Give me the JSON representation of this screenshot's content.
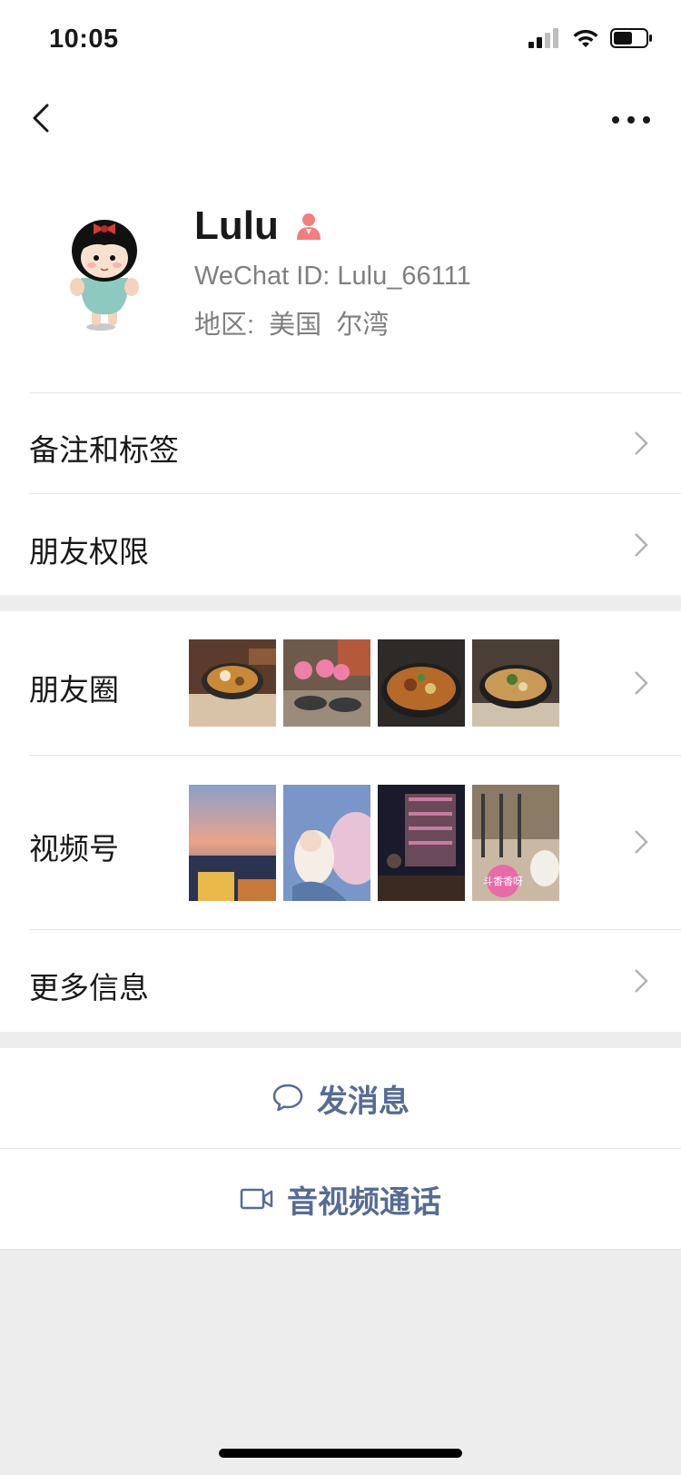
{
  "status": {
    "time": "10:05"
  },
  "profile": {
    "name": "Lulu",
    "wechat_id": "WeChat ID: Lulu_66111",
    "region_label": "地区:",
    "region_country": "美国",
    "region_city": "尔湾"
  },
  "menu": {
    "remarks_tags": "备注和标签",
    "friend_permissions": "朋友权限",
    "moments": "朋友圈",
    "channels": "视频号",
    "more_info": "更多信息"
  },
  "channels_thumb_caption": "斗香香呀",
  "actions": {
    "send_message": "发消息",
    "av_call": "音视频通话"
  },
  "colors": {
    "accent": "#576b95",
    "page_bg": "#ededed",
    "gender_female": "#f37e7d"
  }
}
